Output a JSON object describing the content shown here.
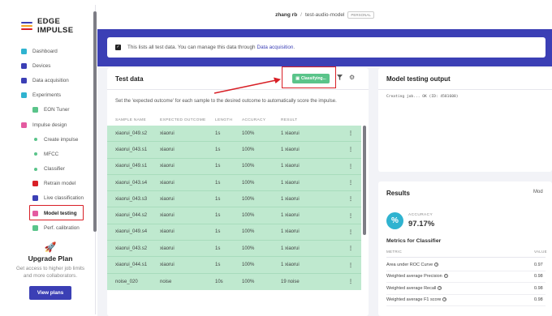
{
  "app": {
    "name": "EDGE IMPULSE",
    "logo_colors": [
      "#3b3fb5",
      "#f5a623",
      "#d81f26"
    ]
  },
  "topbar": {
    "user": "zhang rb",
    "separator": "/",
    "project": "test-audio-model",
    "badge": "PERSONAL"
  },
  "sidebar": {
    "items": [
      {
        "label": "Dashboard",
        "icon": "monitor-icon",
        "color": "#2fb3d0"
      },
      {
        "label": "Devices",
        "icon": "devices-icon",
        "color": "#3b3fb5"
      },
      {
        "label": "Data acquisition",
        "icon": "database-icon",
        "color": "#3b3fb5"
      },
      {
        "label": "Experiments",
        "icon": "experiments-icon",
        "color": "#2fb3d0"
      },
      {
        "label": "EON Tuner",
        "icon": "tuner-icon",
        "color": "#5ac48a"
      },
      {
        "label": "Impulse design",
        "icon": "pulse-icon",
        "color": "#e45aa0"
      },
      {
        "label": "Create impulse",
        "icon": "dot-icon",
        "color": "#5ac48a"
      },
      {
        "label": "MFCC",
        "icon": "dot-icon",
        "color": "#5ac48a"
      },
      {
        "label": "Classifier",
        "icon": "dot-icon",
        "color": "#5ac48a"
      },
      {
        "label": "Retrain model",
        "icon": "retrain-icon",
        "color": "#d81f26"
      },
      {
        "label": "Live classification",
        "icon": "live-icon",
        "color": "#3b3fb5"
      },
      {
        "label": "Model testing",
        "icon": "trash-icon",
        "color": "#e45aa0"
      },
      {
        "label": "Perf. calibration",
        "icon": "calibration-icon",
        "color": "#5ac48a"
      }
    ],
    "upgrade": {
      "title": "Upgrade Plan",
      "text": "Get access to higher job limits and more collaborators.",
      "button": "View plans"
    }
  },
  "infobar": {
    "text": "This lists all test data. You can manage this data through ",
    "link": "Data acquisition",
    "suffix": "."
  },
  "test_data": {
    "title": "Test data",
    "classify_label": "Classifying...",
    "instructions": "Set the 'expected outcome' for each sample to the desired outcome to automatically score the impulse.",
    "columns": [
      "SAMPLE NAME",
      "EXPECTED OUTCOME",
      "LENGTH",
      "ACCURACY",
      "RESULT"
    ],
    "rows": [
      {
        "name": "xiaorui_049.s2",
        "expected": "xiaorui",
        "length": "1s",
        "accuracy": "100%",
        "result": "1 xiaorui"
      },
      {
        "name": "xiaorui_043.s1",
        "expected": "xiaorui",
        "length": "1s",
        "accuracy": "100%",
        "result": "1 xiaorui"
      },
      {
        "name": "xiaorui_049.s1",
        "expected": "xiaorui",
        "length": "1s",
        "accuracy": "100%",
        "result": "1 xiaorui"
      },
      {
        "name": "xiaorui_043.s4",
        "expected": "xiaorui",
        "length": "1s",
        "accuracy": "100%",
        "result": "1 xiaorui"
      },
      {
        "name": "xiaorui_043.s3",
        "expected": "xiaorui",
        "length": "1s",
        "accuracy": "100%",
        "result": "1 xiaorui"
      },
      {
        "name": "xiaorui_044.s2",
        "expected": "xiaorui",
        "length": "1s",
        "accuracy": "100%",
        "result": "1 xiaorui"
      },
      {
        "name": "xiaorui_049.s4",
        "expected": "xiaorui",
        "length": "1s",
        "accuracy": "100%",
        "result": "1 xiaorui"
      },
      {
        "name": "xiaorui_043.s2",
        "expected": "xiaorui",
        "length": "1s",
        "accuracy": "100%",
        "result": "1 xiaorui"
      },
      {
        "name": "xiaorui_044.s1",
        "expected": "xiaorui",
        "length": "1s",
        "accuracy": "100%",
        "result": "1 xiaorui"
      },
      {
        "name": "noise_020",
        "expected": "noise",
        "length": "10s",
        "accuracy": "100%",
        "result": "19 noise"
      }
    ],
    "row_color": "#bfe9cf"
  },
  "output": {
    "title": "Model testing output",
    "log": "Creating job... OK (ID: 4581608)"
  },
  "results": {
    "title": "Results",
    "tab": "Mod",
    "accuracy_label": "ACCURACY",
    "accuracy_value": "97.17%",
    "metrics_title": "Metrics for Classifier",
    "metrics_header": [
      "METRIC",
      "VALUE"
    ],
    "metrics": [
      {
        "metric": "Area under ROC Curve",
        "value": "0.97"
      },
      {
        "metric": "Weighted average Precision",
        "value": "0.98"
      },
      {
        "metric": "Weighted average Recall",
        "value": "0.98"
      },
      {
        "metric": "Weighted average F1 score",
        "value": "0.98"
      }
    ]
  },
  "annotation_color": "#d81f26"
}
